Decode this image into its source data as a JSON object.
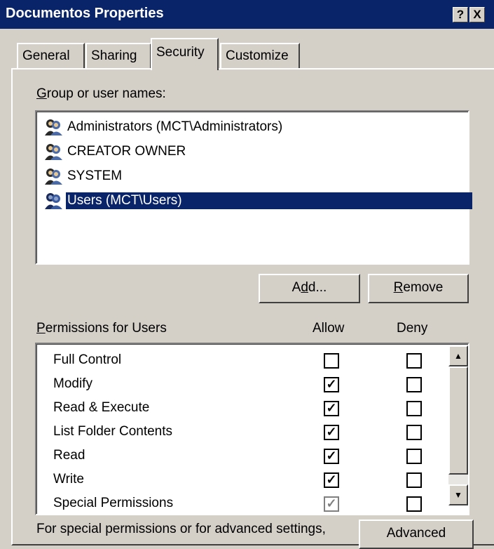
{
  "window": {
    "title": "Documentos Properties",
    "help_glyph": "?",
    "close_glyph": "X"
  },
  "tabs": [
    {
      "label": "General",
      "active": false
    },
    {
      "label": "Sharing",
      "active": false
    },
    {
      "label": "Security",
      "active": true
    },
    {
      "label": "Customize",
      "active": false
    }
  ],
  "security": {
    "group_label_mnemonic": "G",
    "group_label_rest": "roup or user names:",
    "users": [
      {
        "name": "Administrators (MCT\\Administrators)",
        "selected": false,
        "icon": "users-group-icon"
      },
      {
        "name": "CREATOR OWNER",
        "selected": false,
        "icon": "users-group-icon"
      },
      {
        "name": "SYSTEM",
        "selected": false,
        "icon": "users-group-icon"
      },
      {
        "name": "Users (MCT\\Users)",
        "selected": true,
        "icon": "users-group-icon"
      }
    ],
    "add_button": {
      "pre": "A",
      "mnemonic": "d",
      "post": "d..."
    },
    "remove_button": {
      "pre": "",
      "mnemonic": "R",
      "post": "emove"
    },
    "permissions_label_mnemonic": "P",
    "permissions_label_rest": "ermissions for Users",
    "allow_header": "Allow",
    "deny_header": "Deny",
    "permissions": [
      {
        "name": "Full Control",
        "allow": false,
        "deny": false,
        "allow_glyph": "",
        "deny_glyph": ""
      },
      {
        "name": "Modify",
        "allow": true,
        "deny": false,
        "allow_glyph": "✓",
        "deny_glyph": ""
      },
      {
        "name": "Read & Execute",
        "allow": true,
        "deny": false,
        "allow_glyph": "✓",
        "deny_glyph": ""
      },
      {
        "name": "List Folder Contents",
        "allow": true,
        "deny": false,
        "allow_glyph": "✓",
        "deny_glyph": ""
      },
      {
        "name": "Read",
        "allow": true,
        "deny": false,
        "allow_glyph": "✓",
        "deny_glyph": ""
      },
      {
        "name": "Write",
        "allow": true,
        "deny": false,
        "allow_glyph": "✓",
        "deny_glyph": ""
      },
      {
        "name": "Special Permissions",
        "allow": true,
        "deny": false,
        "allow_glyph": "✓",
        "deny_glyph": ""
      }
    ],
    "scroll_up_glyph": "▲",
    "scroll_down_glyph": "▼",
    "advanced_text": "For special permissions or for advanced settings,",
    "advanced_button": "Advanced"
  },
  "colors": {
    "titlebar": "#0a246a",
    "face": "#d4d0c8",
    "selection": "#0a246a"
  }
}
